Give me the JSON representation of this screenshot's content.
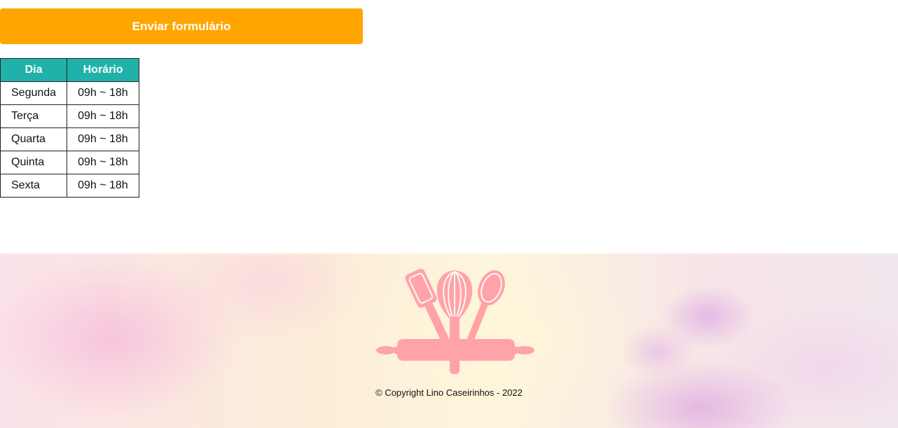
{
  "form": {
    "submit_label": "Enviar formulário"
  },
  "schedule": {
    "headers": [
      "Dia",
      "Horário"
    ],
    "rows": [
      {
        "day": "Segunda",
        "hours": "09h ~ 18h"
      },
      {
        "day": "Terça",
        "hours": "09h ~ 18h"
      },
      {
        "day": "Quarta",
        "hours": "09h ~ 18h"
      },
      {
        "day": "Quinta",
        "hours": "09h ~ 18h"
      },
      {
        "day": "Sexta",
        "hours": "09h ~ 18h"
      }
    ]
  },
  "footer": {
    "logo_icon": "kitchen-utensils-logo-icon",
    "copyright": "© Copyright Lino Caseirinhos - 2022"
  },
  "colors": {
    "button": "#ffa500",
    "table_header": "#20b2aa",
    "logo": "#ffa3a8"
  }
}
